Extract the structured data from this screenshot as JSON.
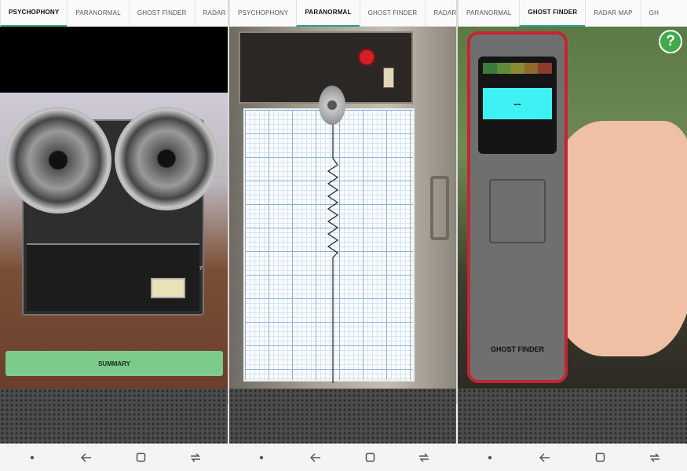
{
  "panels": [
    {
      "tabs": [
        "PSYCHOPHONY",
        "PARANORMAL",
        "GHOST FINDER",
        "RADAR"
      ],
      "active_tab": 0,
      "summary_label": "SUMMARY",
      "deck_label": "ON/OFF"
    },
    {
      "tabs": [
        "PSYCHOPHONY",
        "PARANORMAL",
        "GHOST FINDER",
        "RADARY"
      ],
      "active_tab": 1
    },
    {
      "tabs": [
        "PARANORMAL",
        "GHOST FINDER",
        "RADAR MAP",
        "GH"
      ],
      "active_tab": 1,
      "lcd_value": "--",
      "device_name": "GHOST FINDER",
      "led_colors": [
        "#3b7b3c",
        "#5e8c3b",
        "#8b8a32",
        "#8e6b2d",
        "#8e3a2c"
      ],
      "help_label": "?"
    }
  ],
  "navbar": {
    "icons": [
      "dot-icon",
      "back-arrow-icon",
      "recent-apps-icon",
      "home-icon"
    ]
  },
  "colors": {
    "tab_indicator": "#2aa08a",
    "summary_button": "#7ccb8a",
    "lcd": "#3ef2f4",
    "device_border": "#c32533",
    "help_button": "#40a94a"
  }
}
